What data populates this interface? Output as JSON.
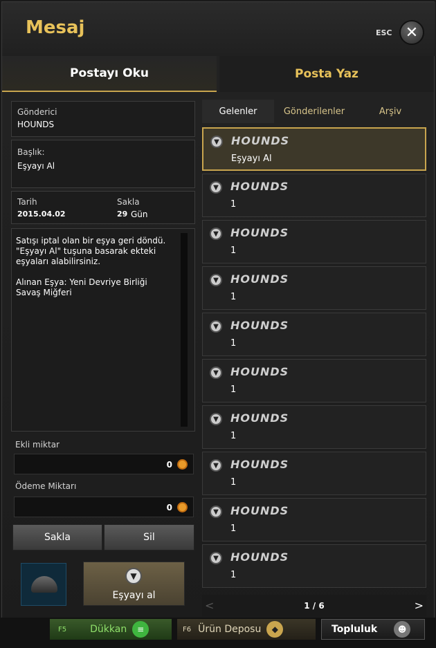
{
  "window": {
    "title": "Mesaj",
    "esc_label": "ESC"
  },
  "main_tabs": {
    "read": "Postayı Oku",
    "write": "Posta Yaz"
  },
  "detail": {
    "sender_label": "Gönderici",
    "sender_value": "HOUNDS",
    "subject_label": "Başlık:",
    "subject_value": "Eşyayı Al",
    "date_label": "Tarih",
    "date_value": "2015.04.02",
    "keep_label": "Sakla",
    "keep_days": "29",
    "keep_unit": "Gün",
    "body": "Satışı iptal olan bir eşya geri döndü.\n\"Eşyayı Al\" tuşuna basarak ekteki eşyaları alabilirsiniz.\n\nAlınan Eşya: Yeni Devriye Birliği Savaş Miğferi",
    "attached_label": "Ekli miktar",
    "attached_value": "0",
    "payment_label": "Ödeme Miktarı",
    "payment_value": "0"
  },
  "buttons": {
    "keep": "Sakla",
    "delete": "Sil",
    "take_item": "Eşyayı al"
  },
  "sub_tabs": [
    "Gelenler",
    "Gönderilenler",
    "Arşiv"
  ],
  "mails": [
    {
      "sender": "HOUNDS",
      "subject": "Eşyayı Al"
    },
    {
      "sender": "HOUNDS",
      "subject": "1"
    },
    {
      "sender": "HOUNDS",
      "subject": "1"
    },
    {
      "sender": "HOUNDS",
      "subject": "1"
    },
    {
      "sender": "HOUNDS",
      "subject": "1"
    },
    {
      "sender": "HOUNDS",
      "subject": "1"
    },
    {
      "sender": "HOUNDS",
      "subject": "1"
    },
    {
      "sender": "HOUNDS",
      "subject": "1"
    },
    {
      "sender": "HOUNDS",
      "subject": "1"
    },
    {
      "sender": "HOUNDS",
      "subject": "1"
    }
  ],
  "pager": {
    "text": "1 / 6",
    "prev": "<",
    "next": ">"
  },
  "bottom_bar": {
    "shop_key": "F5",
    "shop_label": "Dükkan",
    "storage_key": "F6",
    "storage_label": "Ürün Deposu",
    "community_label": "Topluluk"
  },
  "colors": {
    "accent": "#c9a54e",
    "title": "#e8c25a",
    "shop_green": "#2e7d2e"
  }
}
